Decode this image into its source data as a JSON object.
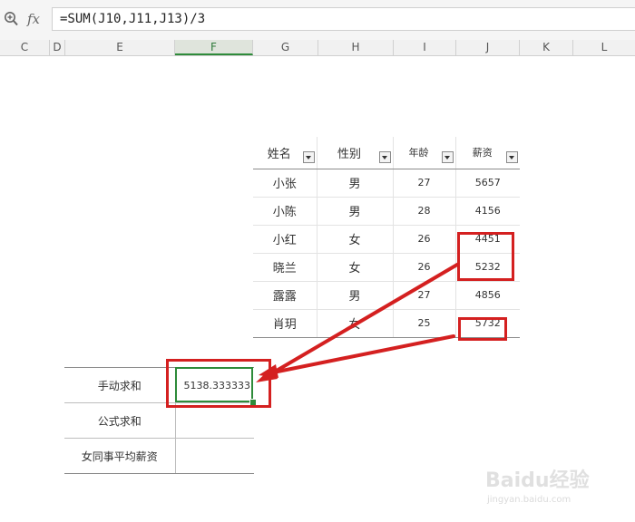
{
  "formula_bar": {
    "fx_label": "fx",
    "formula": "=SUM(J10,J11,J13)/3"
  },
  "columns": [
    "C",
    "D",
    "E",
    "F",
    "G",
    "H",
    "I",
    "J",
    "K",
    "L"
  ],
  "employee_table": {
    "headers": [
      "姓名",
      "性别",
      "年龄",
      "薪资"
    ],
    "rows": [
      [
        "小张",
        "男",
        "27",
        "5657"
      ],
      [
        "小陈",
        "男",
        "28",
        "4156"
      ],
      [
        "小红",
        "女",
        "26",
        "4451"
      ],
      [
        "晓兰",
        "女",
        "26",
        "5232"
      ],
      [
        "露露",
        "男",
        "27",
        "4856"
      ],
      [
        "肖玥",
        "女",
        "25",
        "5732"
      ]
    ]
  },
  "summary_table": {
    "rows": [
      {
        "label": "手动求和",
        "value": "5138.333333"
      },
      {
        "label": "公式求和",
        "value": ""
      },
      {
        "label": "女同事平均薪资",
        "value": ""
      }
    ]
  },
  "watermark": {
    "brand": "Baidu经验",
    "url": "jingyan.baidu.com"
  },
  "colors": {
    "annotation_red": "#d42020",
    "selection_green": "#2e8b3a"
  },
  "icons": {
    "zoom": "zoom-icon",
    "filter": "filter-dropdown-icon"
  }
}
